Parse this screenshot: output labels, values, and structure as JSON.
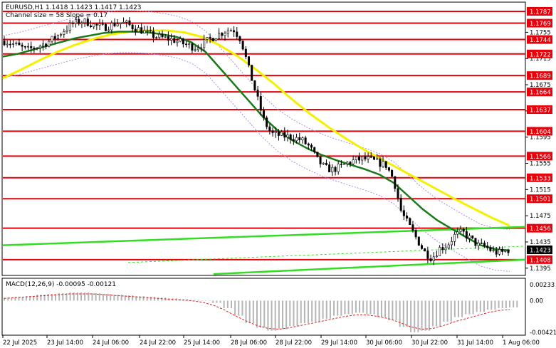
{
  "header": {
    "symbol_line": "EURUSD,H1  1.1418 1.1423 1.1417 1.1423",
    "channel_line": "Channel size = 58 Slope = 0.17"
  },
  "colors": {
    "background": "#ffffff",
    "level_line": "#e8000b",
    "level_label_bg": "#e8000b",
    "bull_candle": "#ffffff",
    "bear_candle": "#000000",
    "ma_fast": "#1a7a1a",
    "ma_slow": "#f5f000",
    "channel": "#33dd22",
    "bollinger": "#b090e0",
    "macd_hist": "#b5b5b5",
    "macd_signal": "#dd2222",
    "price_tag_bg": "#000000"
  },
  "chart_data": {
    "type": "candlestick",
    "symbol": "EURUSD",
    "timeframe": "H1",
    "ohlc_last": {
      "open": 1.1418,
      "high": 1.1423,
      "low": 1.1417,
      "close": 1.1423
    },
    "current_price": "1.1423",
    "price_range": [
      1.1385,
      1.18
    ],
    "support_resistance_levels": [
      "1.1787",
      "1.1769",
      "1.1744",
      "1.1722",
      "1.1689",
      "1.1664",
      "1.1637",
      "1.1604",
      "1.1566",
      "1.1533",
      "1.1501",
      "1.1456",
      "1.1408"
    ],
    "price_axis_ticks": [
      "1.1755",
      "1.1715",
      "1.1675",
      "1.1635",
      "1.1595",
      "1.1555",
      "1.1515",
      "1.1475",
      "1.1435",
      "1.1395"
    ],
    "time_axis_labels": [
      "22 Jul 2025",
      "23 Jul 14:00",
      "24 Jul 06:00",
      "24 Jul 22:00",
      "25 Jul 14:00",
      "28 Jul 06:00",
      "28 Jul 22:00",
      "29 Jul 14:00",
      "30 Jul 06:00",
      "30 Jul 22:00",
      "31 Jul 14:00",
      "1 Aug 06:00"
    ],
    "close_path": [
      1.1742,
      1.1738,
      1.1733,
      1.1728,
      1.1732,
      1.1736,
      1.1742,
      1.175,
      1.176,
      1.1768,
      1.1772,
      1.177,
      1.1765,
      1.1762,
      1.1766,
      1.177,
      1.1768,
      1.1762,
      1.1758,
      1.1752,
      1.1748,
      1.1746,
      1.1744,
      1.174,
      1.1735,
      1.1732,
      1.1738,
      1.1745,
      1.1752,
      1.1757,
      1.176,
      1.1744,
      1.17,
      1.166,
      1.162,
      1.16,
      1.1598,
      1.1596,
      1.1594,
      1.159,
      1.158,
      1.156,
      1.1548,
      1.1545,
      1.155,
      1.1556,
      1.156,
      1.1562,
      1.156,
      1.1556,
      1.1552,
      1.153,
      1.148,
      1.146,
      1.144,
      1.142,
      1.141,
      1.1425,
      1.143,
      1.1445,
      1.145,
      1.144,
      1.143,
      1.1428,
      1.142,
      1.1418,
      1.1423
    ],
    "ma_fast": [
      1.1718,
      1.1722,
      1.1728,
      1.1734,
      1.174,
      1.1746,
      1.175,
      1.1754,
      1.1756,
      1.1756,
      1.1755,
      1.1752,
      1.1748,
      1.174,
      1.1725,
      1.17,
      1.1675,
      1.165,
      1.1625,
      1.1605,
      1.159,
      1.1578,
      1.1568,
      1.156,
      1.1553,
      1.1546,
      1.1538,
      1.1525,
      1.1505,
      1.1485,
      1.1468,
      1.1455,
      1.1442,
      1.143,
      1.1424,
      1.1422
    ],
    "ma_slow": [
      1.1685,
      1.1698,
      1.1712,
      1.1725,
      1.1736,
      1.1745,
      1.1752,
      1.1756,
      1.1758,
      1.1758,
      1.1755,
      1.1748,
      1.1735,
      1.1718,
      1.1698,
      1.1676,
      1.1652,
      1.163,
      1.161,
      1.1592,
      1.1575,
      1.156,
      1.1545,
      1.153,
      1.1515,
      1.15,
      1.1486,
      1.1472,
      1.146
    ],
    "channel_upper": [
      1.143,
      1.1458
    ],
    "channel_lower": [
      1.1386,
      1.1408
    ],
    "macd": {
      "label": "MACD(12,26,9) -0.00095 -0.00121",
      "axis_ticks": [
        "0.00233",
        "0.00",
        "-0.00421"
      ],
      "range": [
        -0.0045,
        0.0026
      ],
      "histogram": [
        0.0004,
        0.0005,
        0.0006,
        0.0008,
        0.0009,
        0.001,
        0.0011,
        0.0011,
        0.001,
        0.0009,
        0.0008,
        0.0007,
        0.0006,
        0.0005,
        0.0004,
        0.0003,
        0.0002,
        0.0001,
        0.0,
        -0.0003,
        -0.001,
        -0.002,
        -0.003,
        -0.0036,
        -0.004,
        -0.0038,
        -0.0034,
        -0.003,
        -0.0028,
        -0.0024,
        -0.002,
        -0.0018,
        -0.0016,
        -0.0018,
        -0.0022,
        -0.0026,
        -0.0035,
        -0.0042,
        -0.004,
        -0.0034,
        -0.0028,
        -0.0022,
        -0.0018,
        -0.0015,
        -0.0012,
        -0.001,
        -0.0009
      ],
      "signal": [
        0.0003,
        0.0004,
        0.0005,
        0.0006,
        0.0007,
        0.0008,
        0.0009,
        0.0009,
        0.0009,
        0.0008,
        0.0007,
        0.0006,
        0.0005,
        0.0004,
        0.0003,
        0.0002,
        0.0001,
        0.0,
        -0.0002,
        -0.0006,
        -0.0012,
        -0.002,
        -0.0027,
        -0.0033,
        -0.0037,
        -0.0038,
        -0.0036,
        -0.0033,
        -0.003,
        -0.0027,
        -0.0024,
        -0.0021,
        -0.0019,
        -0.0019,
        -0.0021,
        -0.0024,
        -0.0029,
        -0.0035,
        -0.0038,
        -0.0037,
        -0.0033,
        -0.0028,
        -0.0024,
        -0.002,
        -0.0016,
        -0.0013,
        -0.0012
      ]
    }
  }
}
